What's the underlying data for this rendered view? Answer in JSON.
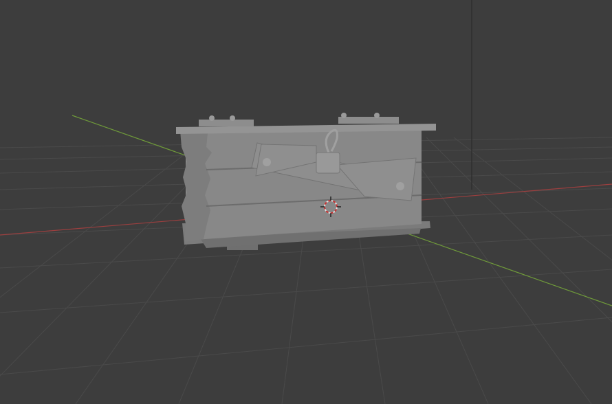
{
  "viewport": {
    "background_color": "#3d3d3d",
    "grid_color": "#4a4a4a",
    "x_axis_color": "#9c3f3f",
    "y_axis_color": "#6f9a3a",
    "z_axis_color": "#2b2b2b"
  },
  "scene": {
    "object": "treasure-chest",
    "object_color": "#8a8a8a",
    "object_shadow_color": "#6f6f6f",
    "cursor_icon": "3d-cursor-icon"
  }
}
